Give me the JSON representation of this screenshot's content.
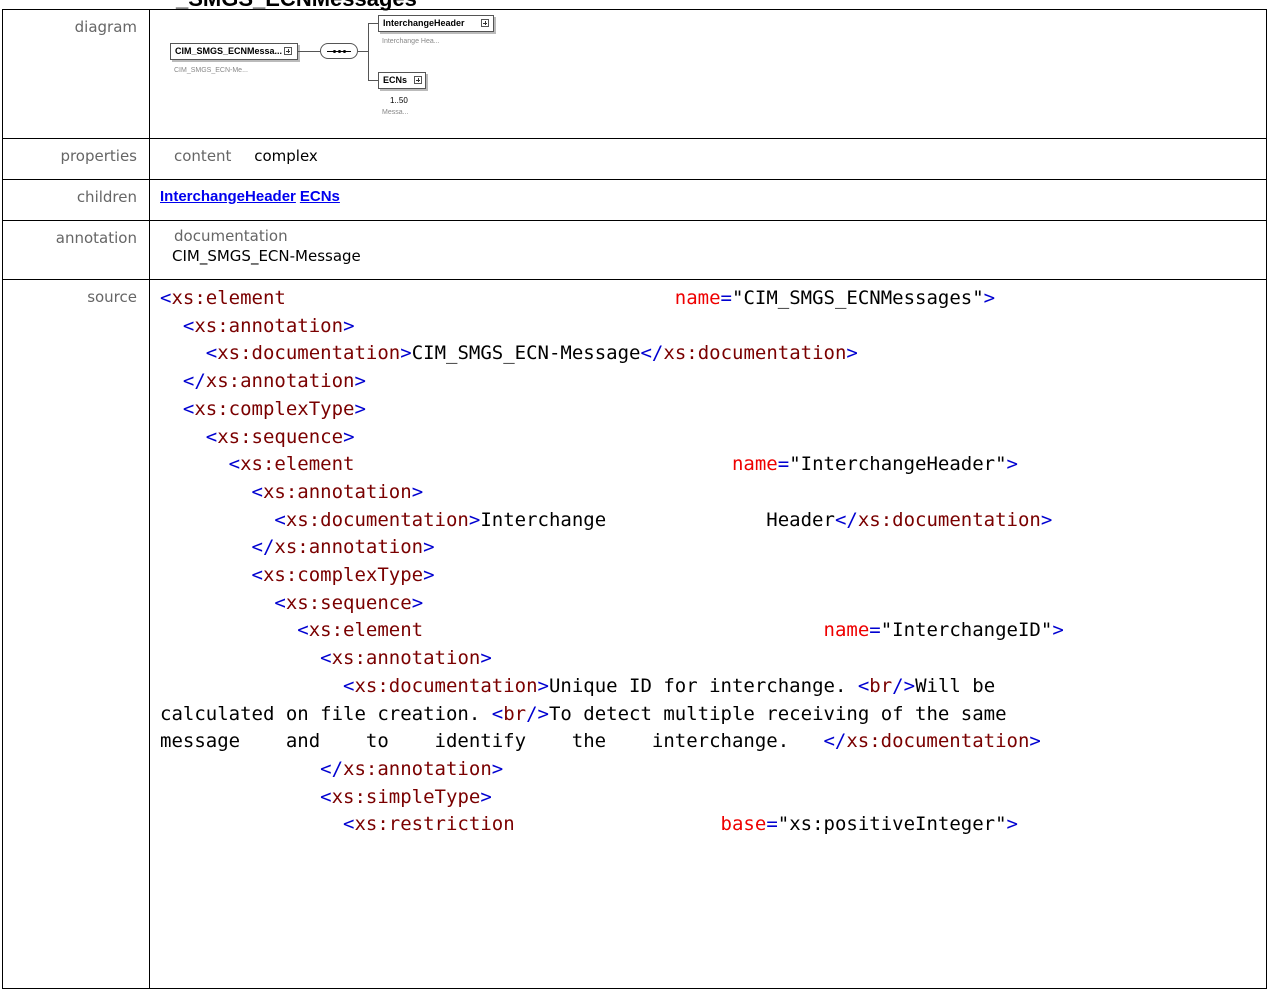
{
  "heading_partial": "_SMGS_ECNMessages",
  "rows": {
    "diagram_label": "diagram",
    "properties_label": "properties",
    "children_label": "children",
    "annotation_label": "annotation",
    "source_label": "source"
  },
  "diagram": {
    "root_name": "CIM_SMGS_ECNMessa...",
    "root_sub": "CIM_SMGS_ECN-Me...",
    "child1_name": "InterchangeHeader",
    "child1_sub": "Interchange Hea...",
    "child2_name": "ECNs",
    "child2_occurs": "1..50",
    "child2_sub": "Messa..."
  },
  "properties": {
    "key": "content",
    "value": "complex"
  },
  "children": [
    "InterchangeHeader",
    "ECNs"
  ],
  "annotation": {
    "key": "documentation",
    "value": "CIM_SMGS_ECN-Message"
  },
  "source_lines": [
    "<xs:element                                  name=\"CIM_SMGS_ECNMessages\">",
    "  <xs:annotation>",
    "    <xs:documentation>CIM_SMGS_ECN-Message</xs:documentation>",
    "  </xs:annotation>",
    "  <xs:complexType>",
    "    <xs:sequence>",
    "      <xs:element                                 name=\"InterchangeHeader\">",
    "        <xs:annotation>",
    "          <xs:documentation>Interchange              Header</xs:documentation>",
    "        </xs:annotation>",
    "        <xs:complexType>",
    "          <xs:sequence>",
    "            <xs:element                                   name=\"InterchangeID\">",
    "              <xs:annotation>",
    "                <xs:documentation>Unique ID for interchange. <br/>Will be",
    "calculated on file creation. <br/>To detect multiple receiving of the same",
    "message    and    to    identify    the    interchange.   </xs:documentation>",
    "              </xs:annotation>",
    "              <xs:simpleType>",
    "                <xs:restriction                  base=\"xs:positiveInteger\">"
  ]
}
